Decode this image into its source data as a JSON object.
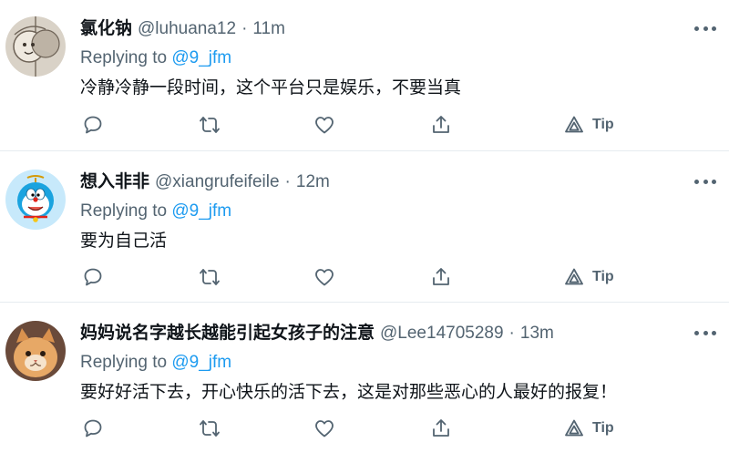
{
  "tweets": [
    {
      "name": "氯化钠",
      "handle": "@luhuana12",
      "dot": "·",
      "time": "11m",
      "replying_to_label": "Replying to",
      "replying_to_handle": "@9_jfm",
      "text": "冷静冷静一段时间，这个平台只是娱乐，不要当真",
      "tip_label": "Tip"
    },
    {
      "name": "想入非非",
      "handle": "@xiangrufeifeile",
      "dot": "·",
      "time": "12m",
      "replying_to_label": "Replying to",
      "replying_to_handle": "@9_jfm",
      "text": "要为自己活",
      "tip_label": "Tip"
    },
    {
      "name": "妈妈说名字越长越能引起女孩子的注意",
      "handle": "@Lee14705289",
      "dot": "·",
      "time": "13m",
      "replying_to_label": "Replying to",
      "replying_to_handle": "@9_jfm",
      "text": "要好好活下去，开心快乐的活下去，这是对那些恶心的人最好的报复！",
      "tip_label": "Tip"
    }
  ],
  "colors": {
    "text_primary": "#0f1419",
    "text_secondary": "#536471",
    "mention": "#1d9bf0",
    "divider": "#e6ecf0"
  },
  "icons": [
    "more-icon",
    "reply-icon",
    "retweet-icon",
    "like-icon",
    "share-icon",
    "tip-icon"
  ]
}
